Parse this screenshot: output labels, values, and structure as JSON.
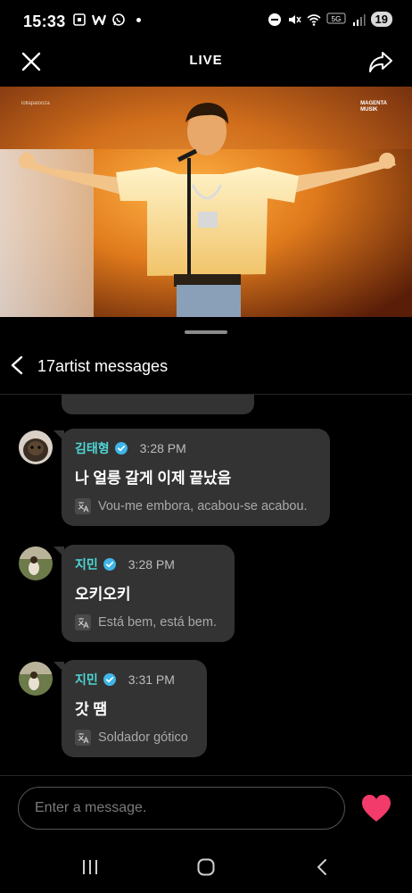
{
  "status_bar": {
    "time": "15:33",
    "battery": "19",
    "network": "5G"
  },
  "header": {
    "title": "LIVE"
  },
  "video": {
    "watermark_left": "lollapalooza",
    "watermark_right_line1": "MAGENTA",
    "watermark_right_line2": "MUSIK"
  },
  "thread": {
    "title": "17artist messages"
  },
  "messages": [
    {
      "sender": "김태형",
      "time": "3:28 PM",
      "text": "나 얼릉 갈게 이제 끝났음",
      "translation": "Vou-me embora, acabou-se acabou."
    },
    {
      "sender": "지민",
      "time": "3:28 PM",
      "text": "오키오키",
      "translation": "Está bem, está bem."
    },
    {
      "sender": "지민",
      "time": "3:31 PM",
      "text": "갓 땜",
      "translation": "Soldador gótico"
    }
  ],
  "composer": {
    "placeholder": "Enter a message."
  },
  "colors": {
    "accent_name": "#4fd6d6",
    "heart": "#f23b6b",
    "bubble": "#333333",
    "verified": "#3fb6e8"
  }
}
